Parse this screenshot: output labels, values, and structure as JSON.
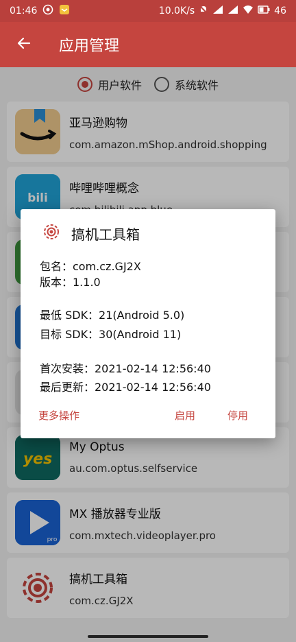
{
  "status_bar": {
    "time": "01:46",
    "speed": "10.0K/s",
    "battery": "46"
  },
  "app_bar": {
    "title": "应用管理"
  },
  "filter": {
    "user_label": "用户软件",
    "system_label": "系统软件",
    "selected": "user"
  },
  "apps": [
    {
      "name": "亚马逊购物",
      "package": "com.amazon.mShop.android.shopping",
      "icon": "amazon-icon"
    },
    {
      "name": "哔哩哔哩概念",
      "package": "com.bilibili.app.blue",
      "icon": "bilibili-icon"
    },
    {
      "name": "",
      "package": "",
      "icon": "green-app-icon"
    },
    {
      "name": "",
      "package": "",
      "icon": "blue-app-icon"
    },
    {
      "name": "",
      "package": "",
      "icon": "blank-app-icon"
    },
    {
      "name": "My Optus",
      "package": "au.com.optus.selfservice",
      "icon": "optus-yes-icon"
    },
    {
      "name": "MX 播放器专业版",
      "package": "com.mxtech.videoplayer.pro",
      "icon": "mx-player-icon"
    },
    {
      "name": "搞机工具箱",
      "package": "com.cz.GJ2X",
      "icon": "gear-icon"
    }
  ],
  "dialog": {
    "title": "搞机工具箱",
    "package_line": "包名：com.cz.GJ2X",
    "version_line": "版本：1.1.0",
    "min_sdk_line": "最低 SDK：21(Android 5.0)",
    "target_sdk_line": "目标 SDK：30(Android 11)",
    "install_line": "首次安装：2021-02-14 12:56:40",
    "update_line": "最后更新：2021-02-14 12:56:40",
    "more_button": "更多操作",
    "enable_button": "启用",
    "disable_button": "停用"
  },
  "colors": {
    "accent": "#c5453f",
    "status_bar": "#b9403c"
  }
}
